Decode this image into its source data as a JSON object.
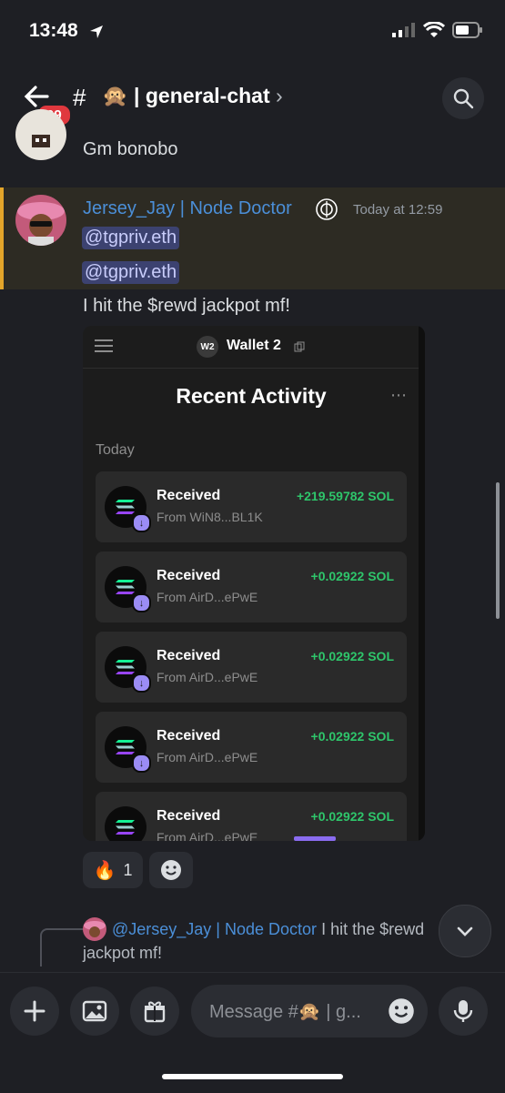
{
  "status_bar": {
    "time": "13:48"
  },
  "header": {
    "badge": "99",
    "channel_emoji": "🙊",
    "channel_name": "| general-chat",
    "chevron": "›"
  },
  "messages": [
    {
      "text": "Gm bonobo"
    },
    {
      "username": "Jersey_Jay | Node Doctor",
      "timestamp": "Today at 12:59",
      "mentions": [
        "@tgpriv.eth",
        "@tgpriv.eth"
      ],
      "text": "I hit the $rewd jackpot mf!"
    }
  ],
  "wallet": {
    "badge": "W2",
    "name": "Wallet 2",
    "title": "Recent Activity",
    "section": "Today",
    "items": [
      {
        "label": "Received",
        "from": "From WiN8...BL1K",
        "amount": "+219.59782 SOL"
      },
      {
        "label": "Received",
        "from": "From AirD...ePwE",
        "amount": "+0.02922 SOL"
      },
      {
        "label": "Received",
        "from": "From AirD...ePwE",
        "amount": "+0.02922 SOL"
      },
      {
        "label": "Received",
        "from": "From AirD...ePwE",
        "amount": "+0.02922 SOL"
      },
      {
        "label": "Received",
        "from": "From AirD...ePwE",
        "amount": "+0.02922 SOL"
      }
    ],
    "icon_colors": {
      "sol_green": "#14f195",
      "sol_purple": "#9945ff",
      "accent": "#2ec66b"
    }
  },
  "reactions": {
    "fire_emoji": "🔥",
    "fire_count": "1"
  },
  "reply_preview": {
    "username": "@Jersey_Jay | Node Doctor",
    "text_part1": "I hit the $rewd",
    "text_part2": "jackpot mf!"
  },
  "composer": {
    "placeholder": "Message #🙊 | g..."
  }
}
